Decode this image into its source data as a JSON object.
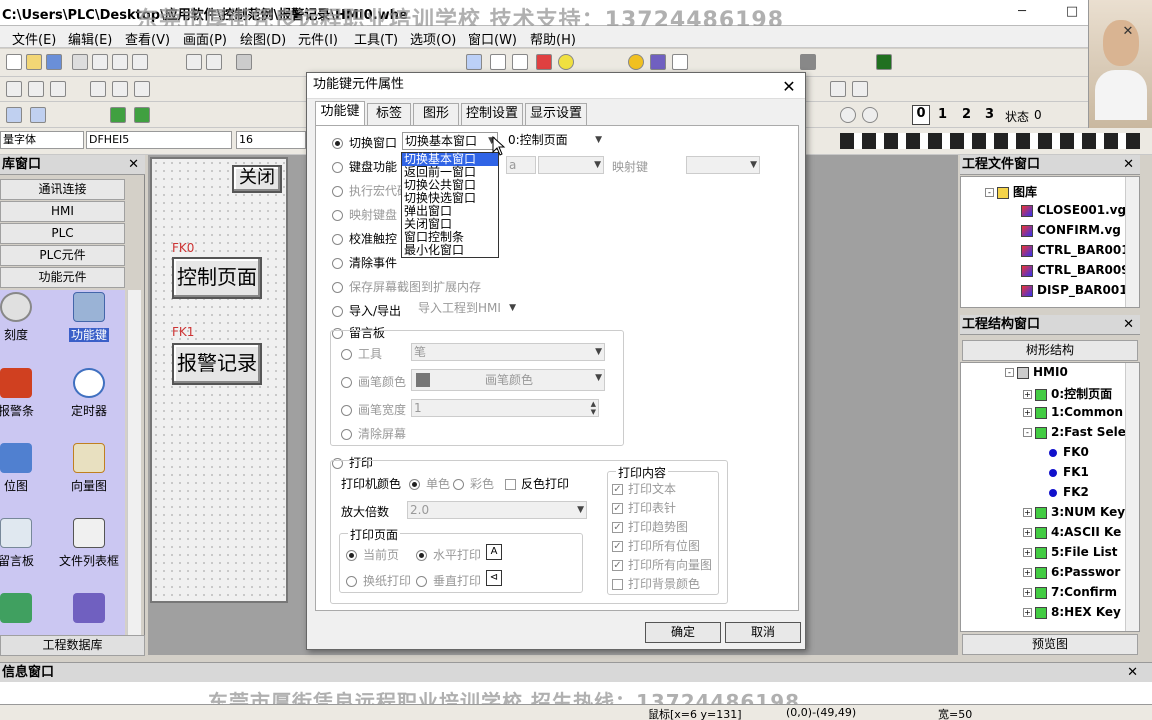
{
  "window": {
    "title": "C:\\Users\\PLC\\Desktop\\应用软件\\控制范例\\报警记录\\HMI0.whe",
    "watermark_top": "东莞市厚街凭良远程职业培训学校  技术支持：13724486198",
    "watermark_bottom": "东莞市厚街凭良远程职业培训学校  招生热线：13724486198",
    "minimize": "─",
    "maximize": "□",
    "close": "✕"
  },
  "menu": [
    "文件(E)",
    "编辑(E)",
    "查看(V)",
    "画面(P)",
    "绘图(D)",
    "元件(I)",
    "工具(T)",
    "选项(O)",
    "窗口(W)",
    "帮助(H)"
  ],
  "fontbar": {
    "font_label": "量字体",
    "font_name": "DFHEI5",
    "font_size": "16"
  },
  "zoombar": {
    "nums": [
      "0",
      "1",
      "2",
      "3"
    ],
    "state_label": "状态",
    "state_value": "0"
  },
  "library": {
    "title": "库窗口",
    "close": "✕",
    "categories": [
      "通讯连接",
      "HMI",
      "PLC",
      "PLC元件",
      "功能元件"
    ],
    "items": [
      "刻度",
      "功能键",
      "报警条",
      "定时器",
      "位图",
      "向量图",
      "留言板",
      "文件列表框",
      "...",
      "..."
    ],
    "footer": "工程数据库"
  },
  "canvas": {
    "close_button": "关闭",
    "fk0_label": "FK0",
    "fk0_button": "控制页面",
    "fk1_label": "FK1",
    "fk1_button": "报警记录"
  },
  "file_window": {
    "title": "工程文件窗口",
    "close": "✕",
    "folder": "图库",
    "files": [
      "CLOSE001.vg",
      "CONFIRM.vg",
      "CTRL_BAR001",
      "CTRL_BAR009",
      "DISP_BAR001"
    ]
  },
  "struct_window": {
    "title": "工程结构窗口",
    "close": "✕",
    "tab": "树形结构",
    "root": "HMI0",
    "nodes": [
      "0:控制页面",
      "1:Common",
      "2:Fast Sele",
      "FK0",
      "FK1",
      "FK2",
      "3:NUM Key",
      "4:ASCII Ke",
      "5:File List",
      "6:Passwor",
      "7:Confirm",
      "8:HEX Key"
    ],
    "footer": "预览图"
  },
  "info_window": {
    "title": "信息窗口",
    "close": "✕"
  },
  "statusbar": {
    "mouse": "鼠标[x=6  y=131]",
    "coords": "(0,0)-(49,49)",
    "width": "宽=50"
  },
  "dialog": {
    "title": "功能键元件属性",
    "close": "✕",
    "tabs": [
      "功能键",
      "标签",
      "图形",
      "控制设置",
      "显示设置"
    ],
    "options": {
      "switch_window": "切换窗口",
      "keyboard": "键盘功能",
      "macro": "执行宏代码",
      "map_key": "映射键盘",
      "calibrate": "校准触控",
      "clear_event": "清除事件",
      "save_screenshot": "保存屏幕截图到扩展内存",
      "import_export": "导入/导出",
      "message_board": "留言板",
      "print": "打印"
    },
    "switch_combo": "切换基本窗口",
    "target_combo": "0:控制页面",
    "keyboard_combo": "a",
    "map_key_label": "映射键",
    "import_combo": "导入工程到HMI",
    "dropdown_items": [
      "切换基本窗口",
      "返回前一窗口",
      "切换公共窗口",
      "切换快选窗口",
      "弹出窗口",
      "关闭窗口",
      "窗口控制条",
      "最小化窗口"
    ],
    "board": {
      "tool_label": "工具",
      "tool_value": "笔",
      "pen_color_label": "画笔颜色",
      "pen_color_value": "画笔颜色",
      "pen_width_label": "画笔宽度",
      "pen_width_value": "1",
      "clear_screen": "清除屏幕"
    },
    "print_group": {
      "color_label": "打印机颜色",
      "mono": "单色",
      "color": "彩色",
      "invert": "反色打印",
      "scale_label": "放大倍数",
      "scale_value": "2.0",
      "page_group": "打印页面",
      "current_page": "当前页",
      "horizontal": "水平打印",
      "page_break": "换纸打印",
      "vertical": "垂直打印",
      "content_group": "打印内容",
      "contents": [
        "打印文本",
        "打印表针",
        "打印趋势图",
        "打印所有位图",
        "打印所有向量图",
        "打印背景颜色"
      ]
    },
    "ok": "确定",
    "cancel": "取消"
  },
  "colors": {
    "accent": "#3064e6",
    "library_bg": "#cbc7f2",
    "fk_label": "#cc3333"
  }
}
